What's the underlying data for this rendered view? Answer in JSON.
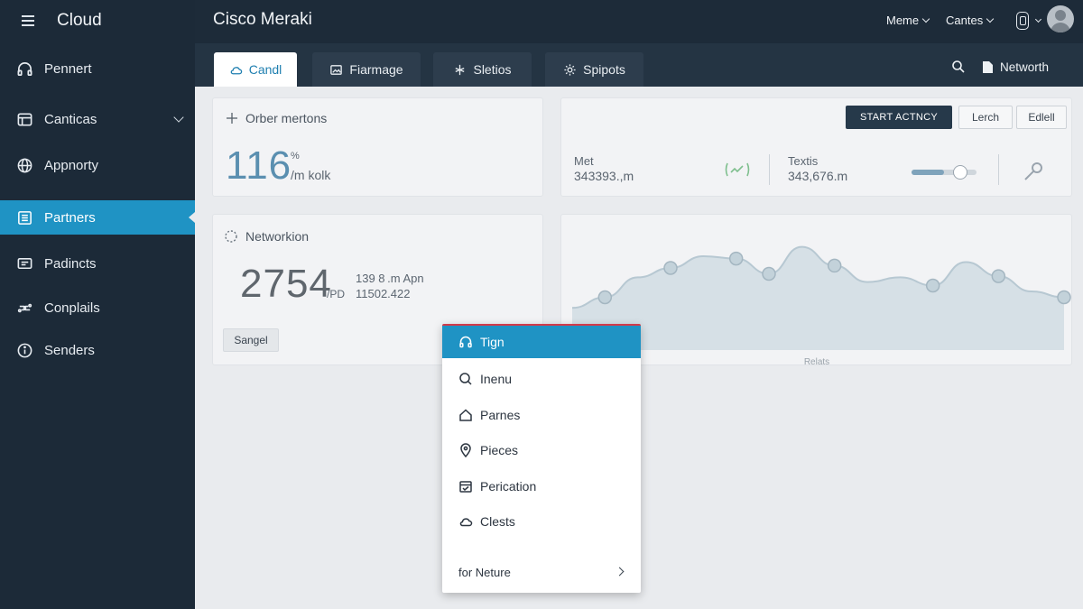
{
  "sidebar": {
    "title": "Cloud",
    "items": [
      {
        "label": "Pennert"
      },
      {
        "label": "Canticas"
      },
      {
        "label": "Appnorty"
      },
      {
        "label": "Partners"
      },
      {
        "label": "Padincts"
      },
      {
        "label": "Conplails"
      },
      {
        "label": "Senders"
      }
    ],
    "active_index": 3
  },
  "topbar": {
    "title": "Cisco Meraki",
    "menu1": "Meme",
    "menu2": "Cantes"
  },
  "tabs": [
    {
      "label": "Candl",
      "icon": "cloud-icon",
      "active": true
    },
    {
      "label": "Fiarmage",
      "icon": "image-icon"
    },
    {
      "label": "Sletios",
      "icon": "network-icon"
    },
    {
      "label": "Spipots",
      "icon": "settings-icon"
    }
  ],
  "tabrow": {
    "network_label": "Networth"
  },
  "card1": {
    "title": "Orber mertons",
    "value": "116",
    "unit": "%",
    "sub": "/m kolk"
  },
  "card2": {
    "start_button": "START ACTNCY",
    "lerch_button": "Lerch",
    "edit_button": "Edlell",
    "met_label": "Met",
    "met_value": "343393.,m",
    "texts_label": "Textis",
    "texts_value": "343,676.m",
    "slider_level": 0.5
  },
  "card3": {
    "title": "Networkion",
    "value": "2754",
    "unit": "/PD",
    "line1": "139 8 .m Apn",
    "line2": "11502.422",
    "button": "Sangel"
  },
  "chart_data": {
    "type": "area",
    "x": [
      1,
      2,
      3,
      4,
      5,
      6,
      7,
      8,
      9,
      10,
      11,
      12,
      13,
      14,
      15,
      16
    ],
    "values": [
      36,
      45,
      62,
      70,
      80,
      78,
      65,
      88,
      72,
      58,
      62,
      55,
      75,
      63,
      50,
      45
    ],
    "marked_points": [
      1,
      3,
      5,
      6,
      8,
      11,
      13,
      15
    ],
    "xlabel": "Relats",
    "ylim": [
      0,
      100
    ],
    "color": "#b7c8d2"
  },
  "dropdown": {
    "items": [
      {
        "label": "Tign",
        "icon": "headphones-icon",
        "selected": true
      },
      {
        "label": "Inenu",
        "icon": "search-icon"
      },
      {
        "label": "Parnes",
        "icon": "home-icon"
      },
      {
        "label": "Pieces",
        "icon": "location-pin-icon"
      },
      {
        "label": "Perication",
        "icon": "calendar-icon"
      },
      {
        "label": "Clests",
        "icon": "cloud-icon"
      }
    ],
    "footer": "for Neture"
  }
}
